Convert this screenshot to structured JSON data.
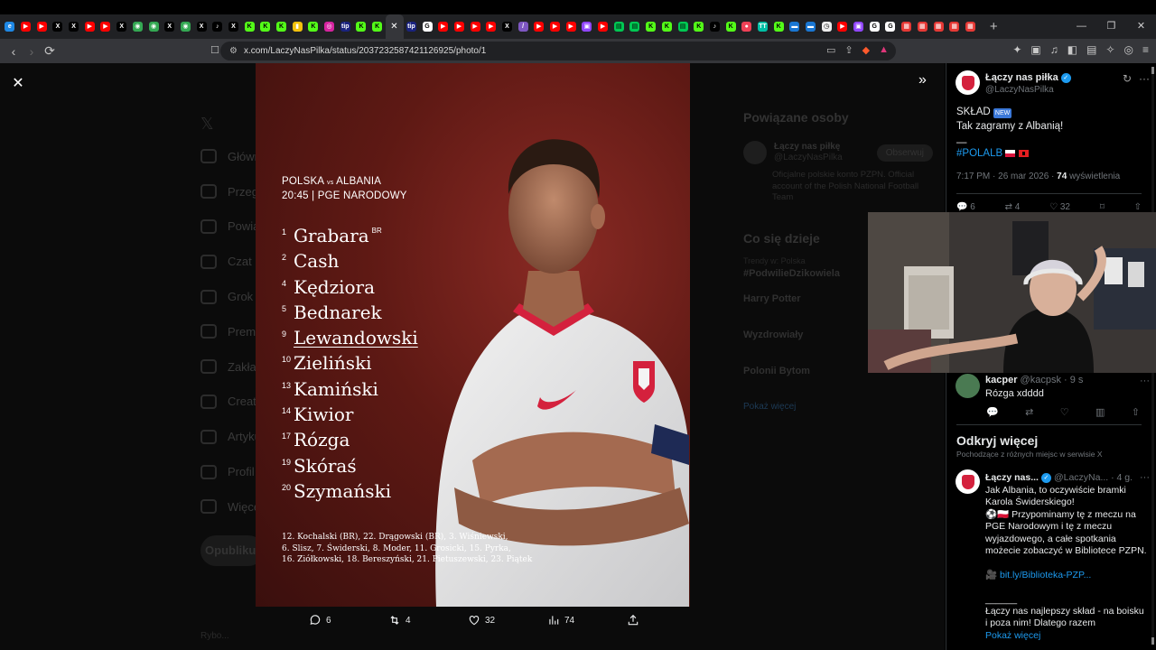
{
  "browser": {
    "url": "x.com/LaczyNasPilka/status/2037232587421126925/photo/1",
    "tab_icons": [
      "edge",
      "youtube",
      "youtube",
      "x",
      "x",
      "youtube",
      "youtube",
      "x",
      "maps",
      "maps",
      "x",
      "maps",
      "x",
      "tiktok",
      "x",
      "kick",
      "kick",
      "kick",
      "yellow",
      "kick",
      "instagram",
      "tip",
      "kick",
      "kick",
      "x-active",
      "tip",
      "google",
      "youtube",
      "youtube",
      "youtube",
      "youtube",
      "x",
      "feather",
      "youtube",
      "youtube",
      "youtube",
      "twitch",
      "youtube",
      "green",
      "green",
      "kick",
      "kick",
      "green",
      "kick",
      "tiktok",
      "kick",
      "pocket",
      "tt",
      "kick",
      "blue",
      "blue",
      "timer",
      "youtube",
      "twitch",
      "google",
      "google",
      "redsq",
      "redsq",
      "redsq",
      "redsq",
      "redsq"
    ],
    "new_tab_label": "+",
    "window_controls": [
      "—",
      "❐",
      "✕"
    ]
  },
  "colors": {
    "accent": "#1d9bf0",
    "poster_red": "#6b1c17",
    "kit_red": "#d4213d"
  },
  "viewer": {
    "close_icon": "✕",
    "expand_icon": "»",
    "actions": {
      "replies": "6",
      "retweets": "4",
      "likes": "32",
      "views": "74"
    }
  },
  "poster": {
    "match_line1_a": "POLSKA",
    "match_vs": "vs",
    "match_line1_b": "ALBANIA",
    "match_line2": "20:45 | PGE NARODOWY",
    "players": [
      {
        "num": "1",
        "name": "Grabara",
        "tag": "BR"
      },
      {
        "num": "2",
        "name": "Cash",
        "tag": ""
      },
      {
        "num": "4",
        "name": "Kędziora",
        "tag": ""
      },
      {
        "num": "5",
        "name": "Bednarek",
        "tag": ""
      },
      {
        "num": "9",
        "name": "Lewandowski",
        "tag": ""
      },
      {
        "num": "10",
        "name": "Zieliński",
        "tag": ""
      },
      {
        "num": "13",
        "name": "Kamiński",
        "tag": ""
      },
      {
        "num": "14",
        "name": "Kiwior",
        "tag": ""
      },
      {
        "num": "17",
        "name": "Rózga",
        "tag": ""
      },
      {
        "num": "19",
        "name": "Skóraś",
        "tag": ""
      },
      {
        "num": "20",
        "name": "Szymański",
        "tag": ""
      }
    ],
    "bench_line1": "12. Kochalski (BR), 22. Drągowski (BR), 3. Wiśniewski,",
    "bench_line2": "6. Slisz, 7. Świderski, 8. Moder, 11. Grosicki, 15. Pyrka,",
    "bench_line3": "16. Ziółkowski, 18. Bereszyński, 21. Pietuszewski, 23. Piątek"
  },
  "background_page": {
    "nav_items": [
      "Główna",
      "Przeglądaj",
      "Powiadomienia",
      "Czat",
      "Grok",
      "Premium",
      "Zakładki",
      "Creator Studio",
      "Artykuły",
      "Profil",
      "Więcej"
    ],
    "post_button": "Opublikuj",
    "related_heading": "Powiązane osoby",
    "related_name": "Łączy nas piłkę",
    "related_handle": "@LaczyNasPilka",
    "related_follow": "Obserwuj",
    "related_bio": "Oficjalne polskie konto PZPN. Official account of the Polish National Football Team",
    "trends_heading": "Co się dzieje",
    "trend_line_1": "Trendy w: Polska",
    "trend_1": "#PodwilieDzikowiela",
    "trend_2": "Harry Potter",
    "trend_3": "Wyzdrowiały",
    "trend_4": "Polonii Bytom",
    "trend_more": "Pokaż więcej",
    "user_line": "Rybo..."
  },
  "tweet": {
    "author": "Łączy nas piłka",
    "handle": "@LaczyNasPilka",
    "grok_icon": "↻",
    "more_icon": "···",
    "line1": "SKŁAD",
    "new_badge": "NEW",
    "line2": "Tak zagramy z Albanią!",
    "dash": "—",
    "hashtag": "#POLALB",
    "time": "7:17 PM · 26 mar 2026 ·",
    "views_count": "74",
    "views_label": "wyświetlenia",
    "stats": {
      "replies": "6",
      "retweets": "4",
      "likes": "32"
    }
  },
  "reply": {
    "author": "kacper",
    "handle": "@kacpsk · 9 s",
    "text": "Rózga xdddd",
    "more_icon": "···"
  },
  "discover": {
    "title": "Odkryj więcej",
    "subtitle": "Pochodzące z różnych miejsc w serwisie X"
  },
  "post2": {
    "author": "Łączy nas...",
    "handle": "@LaczyNa... · 4 g.",
    "more_icon": "···",
    "line1": "Jak Albania, to oczywiście bramki Karola Świderskiego!",
    "line2": "⚽🇵🇱 Przypominamy tę z meczu na PGE Narodowym i tę z meczu wyjazdowego, a całe spotkania możecie zobaczyć w Bibliotece PZPN.",
    "link": "bit.ly/Biblioteka-PZP...",
    "line3": "______",
    "line4": "Łączy nas najlepszy skład - na boisku i poza nim! Dlatego razem",
    "more_link": "Pokaż więcej"
  }
}
